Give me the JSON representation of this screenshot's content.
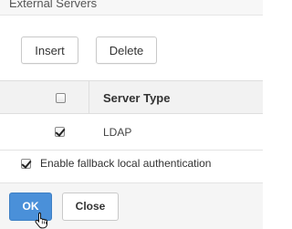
{
  "section": {
    "title": "External Servers"
  },
  "toolbar": {
    "insert_label": "Insert",
    "delete_label": "Delete"
  },
  "table": {
    "header": {
      "select_all_checked": false,
      "column_label": "Server Type"
    },
    "rows": [
      {
        "checked": true,
        "server_type": "LDAP"
      }
    ]
  },
  "fallback": {
    "checked": true,
    "label": "Enable fallback local authentication"
  },
  "footer": {
    "ok_label": "OK",
    "close_label": "Close"
  },
  "colors": {
    "accent": "#4a90d9"
  },
  "cursor": {
    "icon": "hand-pointer-icon"
  }
}
